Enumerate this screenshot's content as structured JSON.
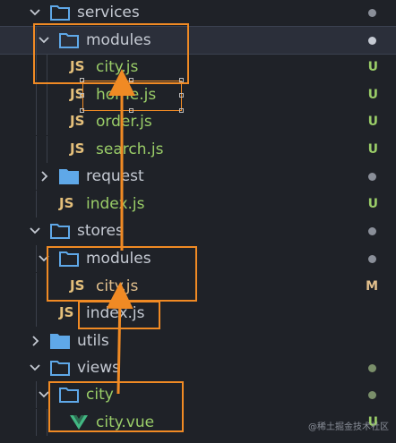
{
  "colors": {
    "background": "#1f2228",
    "folder_icon": "#5fa8e8",
    "js_icon": "#e5c07b",
    "vue_icon": "#42b883",
    "untracked": "#9acd68",
    "modified": "#e2c08d",
    "annotation": "#f08a24"
  },
  "tree": {
    "rows": [
      {
        "label": "services",
        "type": "folder",
        "expanded": true,
        "status": "dot"
      },
      {
        "label": "modules",
        "type": "folder",
        "expanded": true,
        "status": "dot",
        "selected": true
      },
      {
        "label": "city.js",
        "type": "js",
        "status": "U"
      },
      {
        "label": "home.js",
        "type": "js",
        "status": "U"
      },
      {
        "label": "order.js",
        "type": "js",
        "status": "U"
      },
      {
        "label": "search.js",
        "type": "js",
        "status": "U"
      },
      {
        "label": "request",
        "type": "folder",
        "expanded": false,
        "status": "dot"
      },
      {
        "label": "index.js",
        "type": "js",
        "status": "U"
      },
      {
        "label": "stores",
        "type": "folder",
        "expanded": true,
        "status": "dot"
      },
      {
        "label": "modules",
        "type": "folder",
        "expanded": true,
        "status": "dot"
      },
      {
        "label": "city.js",
        "type": "js",
        "status": "M"
      },
      {
        "label": "index.js",
        "type": "js",
        "status": ""
      },
      {
        "label": "utils",
        "type": "folder",
        "expanded": false,
        "status": ""
      },
      {
        "label": "views",
        "type": "folder",
        "expanded": true,
        "status": "dot"
      },
      {
        "label": "city",
        "type": "folder",
        "expanded": true,
        "status": "dot"
      },
      {
        "label": "city.vue",
        "type": "vue",
        "status": "U"
      }
    ]
  },
  "watermark": "@稀土掘金技术社区"
}
